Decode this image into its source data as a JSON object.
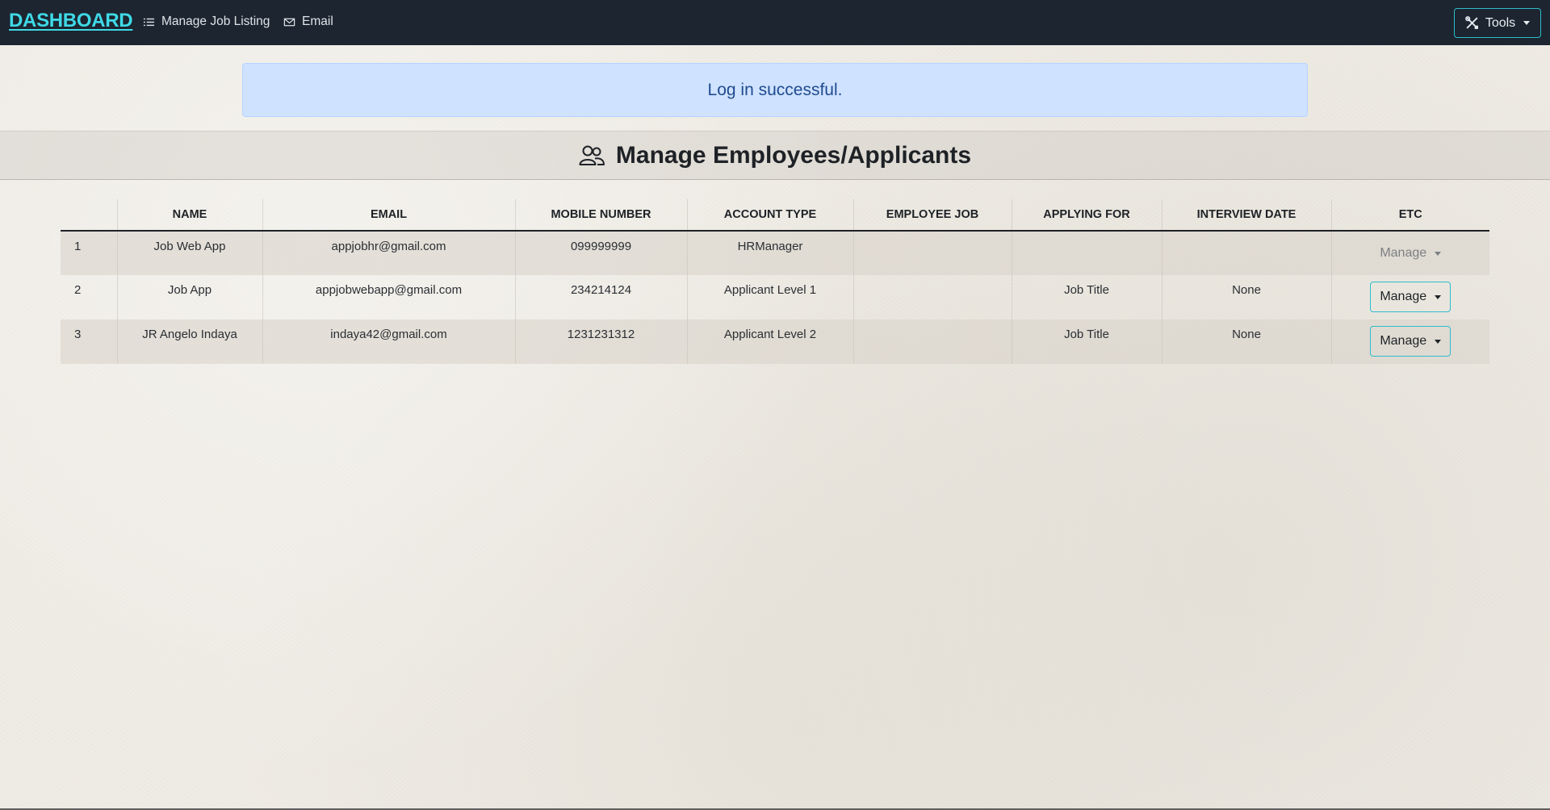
{
  "navbar": {
    "brand": "DASHBOARD",
    "links": [
      {
        "label": "Manage Job Listing",
        "icon": "list-icon"
      },
      {
        "label": "Email",
        "icon": "envelope-icon"
      }
    ],
    "tools_label": "Tools"
  },
  "alert": {
    "message": "Log in successful."
  },
  "page": {
    "title": "Manage Employees/Applicants"
  },
  "table": {
    "headers": [
      "",
      "NAME",
      "EMAIL",
      "MOBILE NUMBER",
      "ACCOUNT TYPE",
      "EMPLOYEE JOB",
      "APPLYING FOR",
      "INTERVIEW DATE",
      "ETC"
    ],
    "rows": [
      {
        "index": "1",
        "name": "Job Web App",
        "email": "appjobhr@gmail.com",
        "mobile": "099999999",
        "account_type": "HRManager",
        "employee_job": "",
        "applying_for": "",
        "interview_date": "",
        "action": "Manage",
        "action_enabled": false
      },
      {
        "index": "2",
        "name": "Job App",
        "email": "appjobwebapp@gmail.com",
        "mobile": "234214124",
        "account_type": "Applicant Level 1",
        "employee_job": "",
        "applying_for": "Job Title",
        "interview_date": "None",
        "action": "Manage",
        "action_enabled": true
      },
      {
        "index": "3",
        "name": "JR Angelo Indaya",
        "email": "indaya42@gmail.com",
        "mobile": "1231231312",
        "account_type": "Applicant Level 2",
        "employee_job": "",
        "applying_for": "Job Title",
        "interview_date": "None",
        "action": "Manage",
        "action_enabled": true
      }
    ]
  },
  "colors": {
    "navbar_bg": "#1c2530",
    "brand": "#3fd9e6",
    "alert_bg": "#cfe2ff",
    "alert_text": "#1f4b8f",
    "button_border": "#2fbccc"
  }
}
